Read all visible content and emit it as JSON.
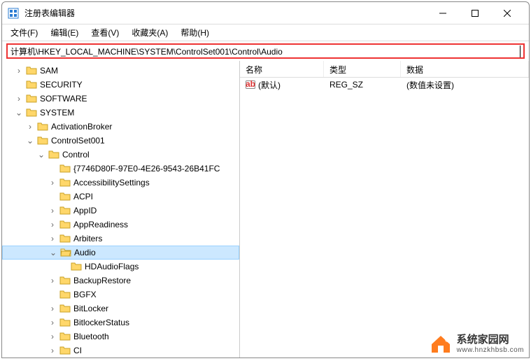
{
  "window": {
    "title": "注册表编辑器"
  },
  "menu": {
    "file": "文件(F)",
    "edit": "编辑(E)",
    "view": "查看(V)",
    "favorites": "收藏夹(A)",
    "help": "帮助(H)"
  },
  "address": {
    "path": "计算机\\HKEY_LOCAL_MACHINE\\SYSTEM\\ControlSet001\\Control\\Audio"
  },
  "tree": {
    "sam": "SAM",
    "security": "SECURITY",
    "software": "SOFTWARE",
    "system": "SYSTEM",
    "activationbroker": "ActivationBroker",
    "controlset001": "ControlSet001",
    "control": "Control",
    "guid": "{7746D80F-97E0-4E26-9543-26B41FC",
    "accessibilitysettings": "AccessibilitySettings",
    "acpi": "ACPI",
    "appid": "AppID",
    "appreadiness": "AppReadiness",
    "arbiters": "Arbiters",
    "audio": "Audio",
    "hdaudioflags": "HDAudioFlags",
    "backuprestore": "BackupRestore",
    "bgfx": "BGFX",
    "bitlocker": "BitLocker",
    "bitlockerstatus": "BitlockerStatus",
    "bluetooth": "Bluetooth",
    "ci": "CI"
  },
  "list": {
    "headers": {
      "name": "名称",
      "type": "类型",
      "data": "数据"
    },
    "rows": [
      {
        "name": "(默认)",
        "type": "REG_SZ",
        "data": "(数值未设置)"
      }
    ]
  },
  "watermark": {
    "cn": "系统家园网",
    "url": "www.hnzkhbsb.com"
  }
}
